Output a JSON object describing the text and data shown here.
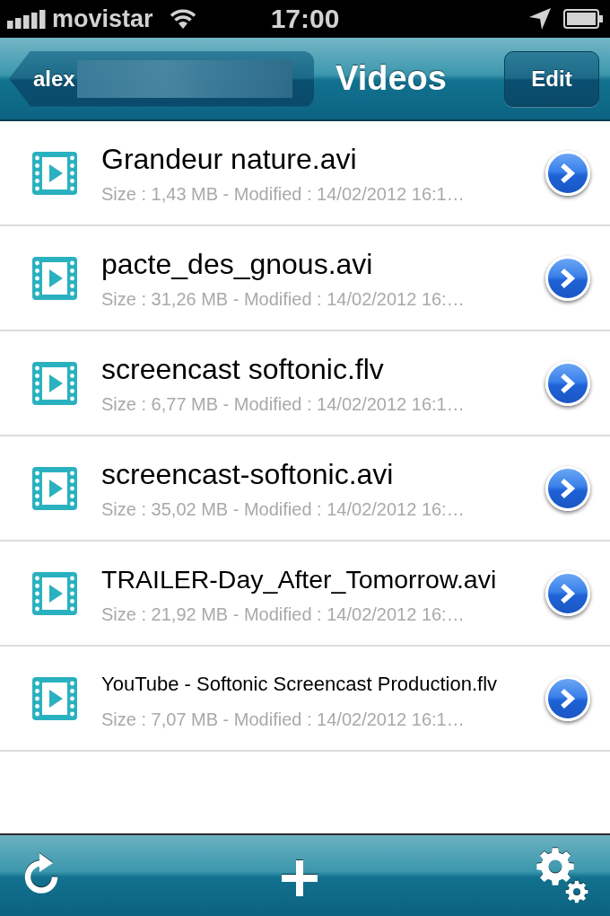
{
  "status_bar": {
    "carrier": "movistar",
    "time": "17:00"
  },
  "nav_bar": {
    "back_button": {
      "label": "alex",
      "redacted": true
    },
    "title": "Videos",
    "edit_button": {
      "label": "Edit"
    }
  },
  "files": [
    {
      "name": "Grandeur nature.avi",
      "details": "Size : 1,43 MB - Modified : 14/02/2012 16:1…"
    },
    {
      "name": "pacte_des_gnous.avi",
      "details": "Size : 31,26 MB - Modified : 14/02/2012 16:…"
    },
    {
      "name": "screencast softonic.flv",
      "details": "Size : 6,77 MB - Modified : 14/02/2012 16:1…"
    },
    {
      "name": "screencast-softonic.avi",
      "details": "Size : 35,02 MB - Modified : 14/02/2012 16:…"
    },
    {
      "name": "TRAILER-Day_After_Tomorrow.avi",
      "details": "Size : 21,92 MB - Modified : 14/02/2012 16:…"
    },
    {
      "name": "YouTube - Softonic Screencast Production.flv",
      "details": "Size : 7,07 MB - Modified : 14/02/2012 16:1…"
    }
  ],
  "toolbar": {
    "items": [
      {
        "kind": "refresh"
      },
      {
        "kind": "add"
      },
      {
        "kind": "settings"
      }
    ]
  }
}
